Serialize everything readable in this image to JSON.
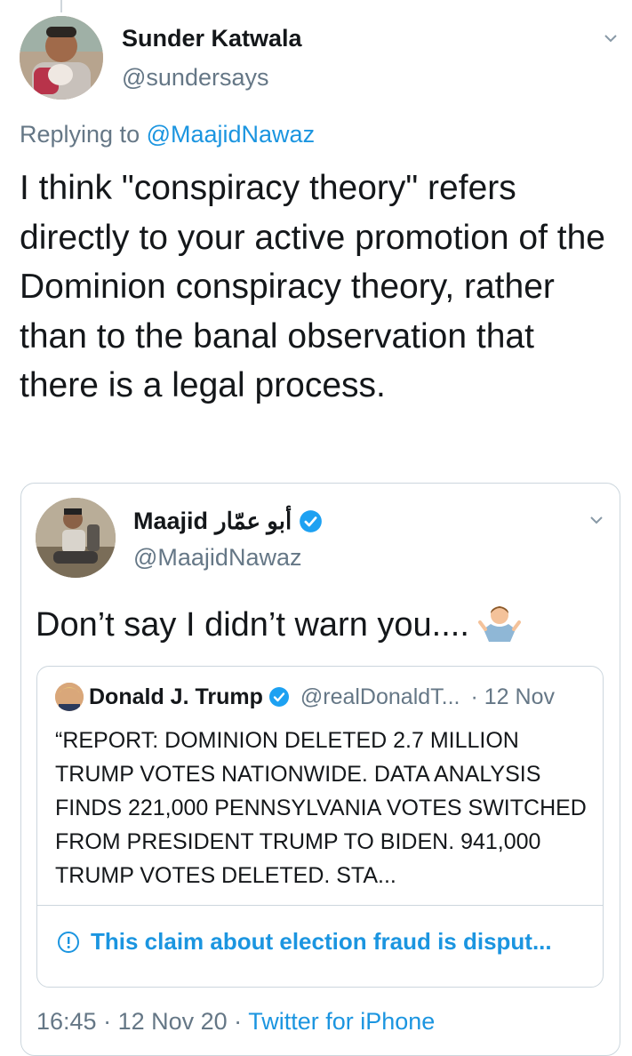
{
  "tweet": {
    "author_name": "Sunder Katwala",
    "author_handle": "@sundersays",
    "replying_prefix": "Replying to ",
    "replying_to": "@MaajidNawaz",
    "text": "I think \"conspiracy theory\" refers directly to your active promotion of the Dominion conspiracy theory, rather than to the banal observation that there is a legal process."
  },
  "quoted": {
    "author_name": "Maajid",
    "author_arabic": "أبو عمّار",
    "author_handle": "@MaajidNawaz",
    "text": "Don’t say I didn’t warn you....",
    "emoji_icon": "person-shrugging-icon",
    "inner": {
      "author_name": "Donald J. Trump",
      "author_handle": "@realDonaldT...",
      "date": "· 12 Nov",
      "text": "“REPORT: DOMINION DELETED 2.7 MILLION TRUMP VOTES NATIONWIDE. DATA ANALYSIS FINDS 221,000 PENNSYLVANIA VOTES SWITCHED FROM PRESIDENT TRUMP TO BIDEN. 941,000 TRUMP VOTES DELETED. STA...",
      "notice": "This claim about election fraud is disput..."
    },
    "meta": {
      "time": "16:45",
      "sep1": " · ",
      "date": "12 Nov 20",
      "sep2": " · ",
      "client": "Twitter for iPhone"
    }
  },
  "colors": {
    "link": "#1b95e0",
    "secondary_text": "#657786",
    "border": "#ccd6dd",
    "verified": "#1da1f2"
  }
}
